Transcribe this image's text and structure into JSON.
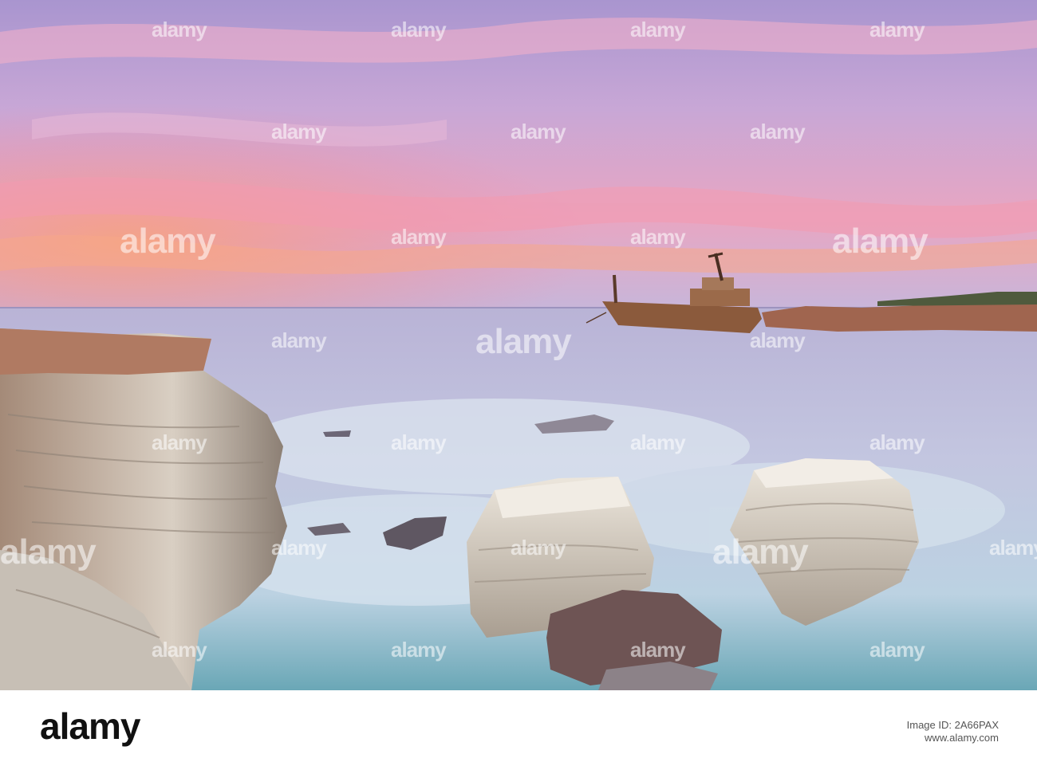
{
  "photo": {
    "watermark_text": "alamy"
  },
  "footer": {
    "logo": "alamy",
    "image_id_line": "Image ID: 2A66PAX",
    "url": "www.alamy.com"
  },
  "colors": {
    "sky_top": "#b7a3d6",
    "sky_pink": "#f08aa6",
    "sky_orange": "#f6a27f",
    "sea": "#b8bfd8",
    "foam": "#d8e4ef",
    "rock": "#c9b7a4",
    "ship_rust": "#8b5a3c"
  }
}
